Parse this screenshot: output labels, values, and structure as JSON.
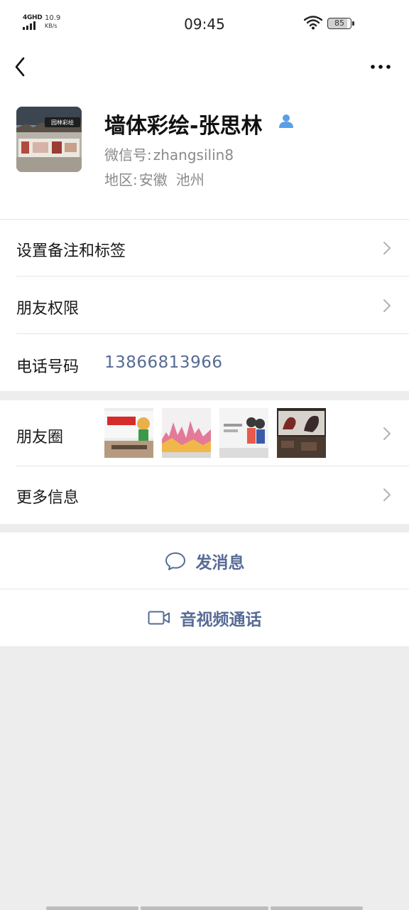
{
  "status_bar": {
    "network": "4GHD",
    "speed_value": "10.9",
    "speed_unit": "KB/s",
    "time": "09:45",
    "battery": "85"
  },
  "nav": {
    "back_icon": "chevron-left-icon",
    "more_icon": "more-dots-icon"
  },
  "profile": {
    "name": "墙体彩绘-张思林",
    "wechat_label": "微信号:",
    "wechat_id": "zhangsilin8",
    "region_label": "地区:",
    "region_province": "安徽",
    "region_city": "池州",
    "avatar_banner": "园林彩绘"
  },
  "rows": {
    "remark_label": "设置备注和标签",
    "permissions_label": "朋友权限",
    "phone_label": "电话号码",
    "phone_value": "13866813966",
    "moments_label": "朋友圈",
    "more_info_label": "更多信息"
  },
  "actions": {
    "message_label": "发消息",
    "call_label": "音视频通话"
  },
  "colors": {
    "link_blue": "#576b95",
    "background": "#ededed",
    "divider": "#e5e5e5"
  }
}
